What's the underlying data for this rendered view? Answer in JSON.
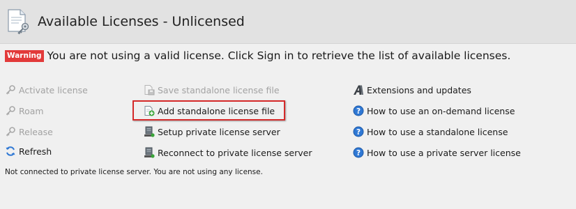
{
  "header": {
    "title": "Available Licenses - Unlicensed",
    "icon": "license-document-icon"
  },
  "warning": {
    "badge": "Warning",
    "text": "You are not using a valid license. Click Sign in to retrieve the list of available licenses."
  },
  "actions_left": [
    {
      "label": "Activate license",
      "icon": "key-icon",
      "enabled": false
    },
    {
      "label": "Roam",
      "icon": "roam-key-icon",
      "enabled": false
    },
    {
      "label": "Release",
      "icon": "release-key-icon",
      "enabled": false
    },
    {
      "label": "Refresh",
      "icon": "refresh-icon",
      "enabled": true
    }
  ],
  "actions_middle": [
    {
      "label": "Save standalone license file",
      "icon": "save-file-icon",
      "enabled": false
    },
    {
      "label": "Add standalone license file",
      "icon": "add-file-icon",
      "enabled": true,
      "highlighted": true
    },
    {
      "label": "Setup private license server",
      "icon": "server-icon",
      "enabled": true
    },
    {
      "label": "Reconnect to private license server",
      "icon": "server-reconnect-icon",
      "enabled": true
    }
  ],
  "actions_right": [
    {
      "label": "Extensions and updates",
      "icon": "extensions-icon"
    },
    {
      "label": "How to use an on-demand license",
      "icon": "help-icon"
    },
    {
      "label": "How to use a standalone license",
      "icon": "help-icon"
    },
    {
      "label": "How to use a private server license",
      "icon": "help-icon"
    }
  ],
  "status": "Not connected to private license server. You are not using any license.",
  "colors": {
    "header_bg": "#e2e2e2",
    "body_bg": "#f0f0f0",
    "warning_badge": "#e23a3a",
    "highlight_border": "#d52a2a",
    "disabled_text": "#a2a2a2",
    "help_blue": "#2f78d4"
  }
}
